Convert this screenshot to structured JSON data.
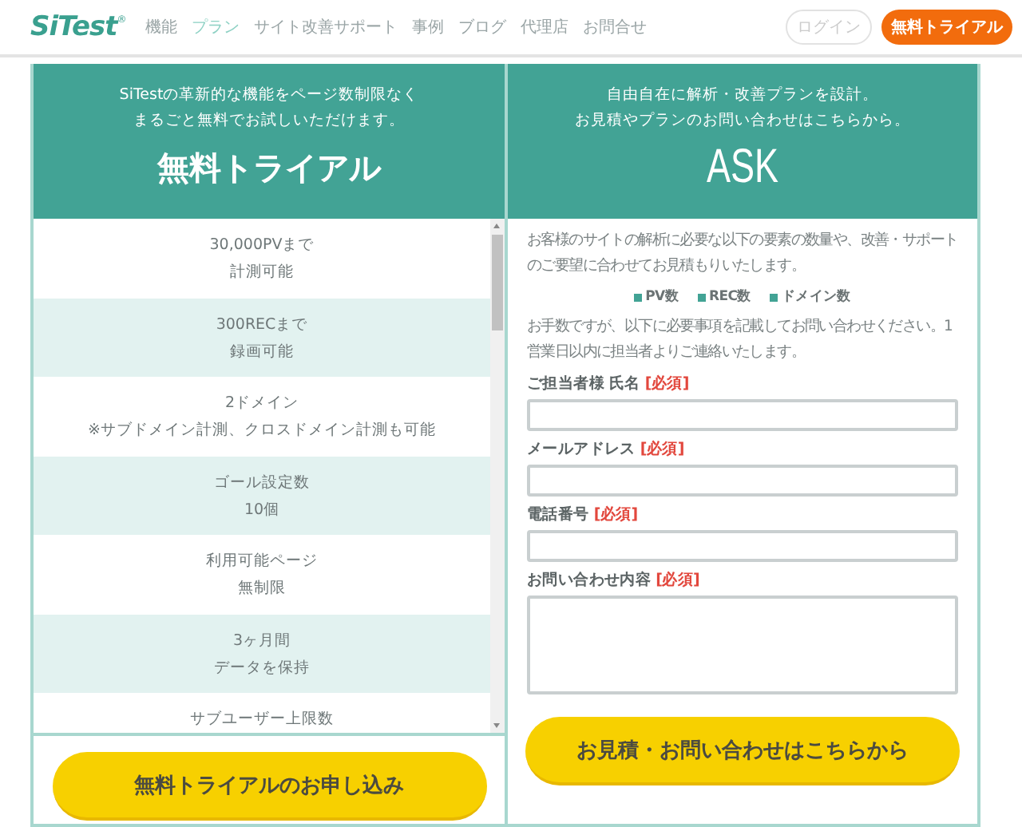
{
  "header": {
    "logo": "SiTest",
    "logo_mark": "®",
    "nav": [
      {
        "label": "機能",
        "selected": false
      },
      {
        "label": "プラン",
        "selected": true
      },
      {
        "label": "サイト改善サポート",
        "selected": false
      },
      {
        "label": "事例",
        "selected": false
      },
      {
        "label": "ブログ",
        "selected": false
      },
      {
        "label": "代理店",
        "selected": false
      },
      {
        "label": "お問合せ",
        "selected": false
      }
    ],
    "login": "ログイン",
    "trial": "無料トライアル"
  },
  "trial_panel": {
    "intro": [
      "SiTestの革新的な機能をページ数制限なく",
      "まるごと無料でお試しいただけます。"
    ],
    "title": "無料トライアル",
    "features": [
      {
        "title": "30,000PVまで",
        "detail": "計測可能"
      },
      {
        "title": "300RECまで",
        "detail": "録画可能"
      },
      {
        "title": "2ドメイン",
        "detail": "※サブドメイン計測、クロスドメイン計測も可能"
      },
      {
        "title": "ゴール設定数",
        "detail": "10個"
      },
      {
        "title": "利用可能ページ",
        "detail": "無制限"
      },
      {
        "title": "3ヶ月間",
        "detail": "データを保持"
      },
      {
        "title": "サブユーザー上限数"
      }
    ],
    "button": "無料トライアルのお申し込み"
  },
  "ask_panel": {
    "intro": [
      "自由自在に解析・改善プランを設計。",
      "お見積やプランのお問い合わせはこちらから。"
    ],
    "title": "ASK",
    "description": "お客様のサイトの解析に必要な以下の要素の数量や、改善・サポートのご要望に合わせてお見積もりいたします。",
    "elements": [
      "PV数",
      "REC数",
      "ドメイン数"
    ],
    "note": "お手数ですが、以下に必要事項を記載してお問い合わせください。1営業日以内に担当者よりご連絡いたします。",
    "fields": [
      {
        "label": "ご担当者様 氏名",
        "required": "[必須]",
        "kind": "input"
      },
      {
        "label": "メールアドレス",
        "required": "[必須]",
        "kind": "input"
      },
      {
        "label": "電話番号",
        "required": "[必須]",
        "kind": "input"
      },
      {
        "label": "お問い合わせ内容",
        "required": "[必須]",
        "kind": "textarea"
      }
    ],
    "button": "お見積・お問い合わせはこちらから"
  }
}
